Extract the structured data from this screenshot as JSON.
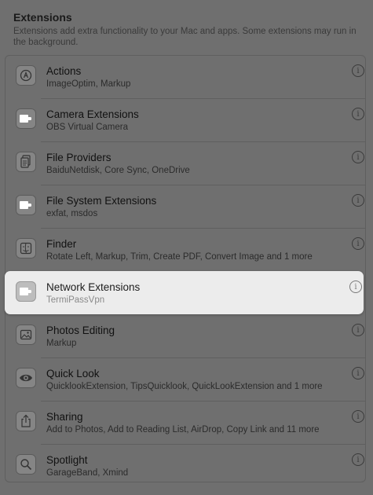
{
  "header": {
    "title": "Extensions",
    "description": "Extensions add extra functionality to your Mac and apps. Some extensions may run in the background."
  },
  "extensions": [
    {
      "title": "Actions",
      "subtitle": "ImageOptim, Markup",
      "icon": "actions-icon"
    },
    {
      "title": "Camera Extensions",
      "subtitle": "OBS Virtual Camera",
      "icon": "extension-puzzle-icon"
    },
    {
      "title": "File Providers",
      "subtitle": "BaiduNetdisk, Core Sync, OneDrive",
      "icon": "documents-icon"
    },
    {
      "title": "File System Extensions",
      "subtitle": "exfat, msdos",
      "icon": "extension-puzzle-icon"
    },
    {
      "title": "Finder",
      "subtitle": "Rotate Left, Markup, Trim, Create PDF, Convert Image and 1 more",
      "icon": "finder-icon"
    },
    {
      "title": "Network Extensions",
      "subtitle": "TermiPassVpn",
      "icon": "extension-puzzle-icon",
      "highlighted": true
    },
    {
      "title": "Photos Editing",
      "subtitle": "Markup",
      "icon": "photo-icon"
    },
    {
      "title": "Quick Look",
      "subtitle": "QuicklookExtension, TipsQuicklook, QuickLookExtension and 1 more",
      "icon": "eye-icon"
    },
    {
      "title": "Sharing",
      "subtitle": "Add to Photos, Add to Reading List, AirDrop, Copy Link and 11 more",
      "icon": "share-icon"
    },
    {
      "title": "Spotlight",
      "subtitle": "GarageBand, Xmind",
      "icon": "magnifier-icon"
    }
  ],
  "info_glyph": "i"
}
